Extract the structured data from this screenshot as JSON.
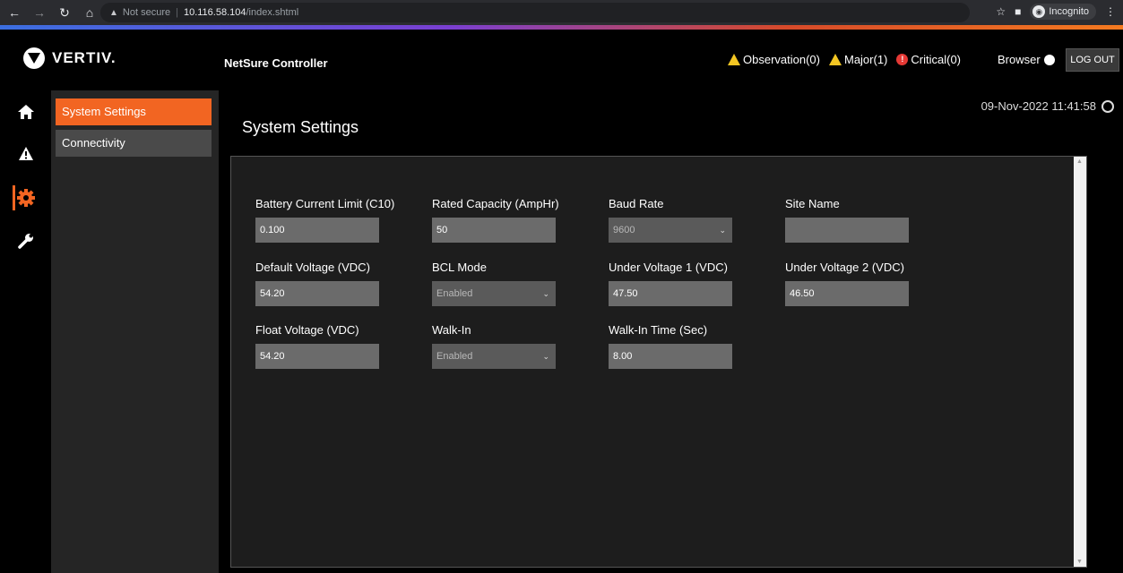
{
  "browser": {
    "not_secure": "Not secure",
    "host": "10.116.58.104",
    "path": "/index.shtml",
    "incognito": "Incognito"
  },
  "header": {
    "brand": "VERTIV.",
    "app_title": "NetSure Controller",
    "alerts": {
      "observation": "Observation(0)",
      "major": "Major(1)",
      "critical": "Critical(0)"
    },
    "browser_label": "Browser",
    "logout": "LOG OUT"
  },
  "rail": {
    "items": [
      {
        "icon": "home-icon"
      },
      {
        "icon": "alarm-icon"
      },
      {
        "icon": "settings-gear-icon",
        "active": true
      },
      {
        "icon": "wrench-icon"
      }
    ]
  },
  "subnav": {
    "items": [
      {
        "label": "System Settings",
        "active": true
      },
      {
        "label": "Connectivity",
        "active": false
      }
    ]
  },
  "main": {
    "datetime": "09-Nov-2022 11:41:58",
    "title": "System Settings",
    "fields": {
      "battery_current_limit": {
        "label": "Battery Current Limit (C10)",
        "value": "0.100"
      },
      "rated_capacity": {
        "label": "Rated Capacity (AmpHr)",
        "value": "50"
      },
      "baud_rate": {
        "label": "Baud Rate",
        "value": "9600"
      },
      "site_name": {
        "label": "Site Name",
        "value": ""
      },
      "default_voltage": {
        "label": "Default Voltage (VDC)",
        "value": "54.20"
      },
      "bcl_mode": {
        "label": "BCL Mode",
        "value": "Enabled"
      },
      "under_voltage_1": {
        "label": "Under Voltage 1 (VDC)",
        "value": "47.50"
      },
      "under_voltage_2": {
        "label": "Under Voltage 2 (VDC)",
        "value": "46.50"
      },
      "float_voltage": {
        "label": "Float Voltage (VDC)",
        "value": "54.20"
      },
      "walk_in": {
        "label": "Walk-In",
        "value": "Enabled"
      },
      "walk_in_time": {
        "label": "Walk-In Time (Sec)",
        "value": "8.00"
      }
    }
  }
}
